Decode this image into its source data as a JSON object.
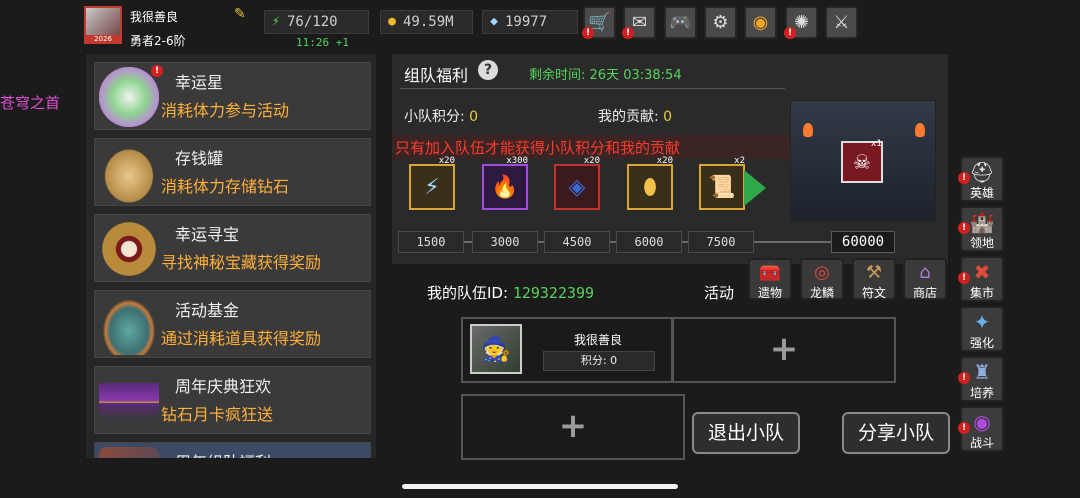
{
  "player": {
    "name": "我很善良",
    "rank": "勇者2-6阶",
    "avatar_level": "2026"
  },
  "stats": {
    "stamina": "76/120",
    "gold": "49.59M",
    "diamonds": "19977",
    "clock": "11:26 +1"
  },
  "topbar_icons": [
    "shop-cart-icon",
    "mail-icon",
    "gamepad-icon",
    "settings-gear-icon",
    "color-wheel-icon",
    "firework-icon",
    "battle-icon"
  ],
  "side_cut_text": "苍穹之首",
  "activities": [
    {
      "title": "幸运星",
      "desc": "消耗体力参与活动",
      "icon": "lucky-star-icon",
      "alert": true
    },
    {
      "title": "存钱罐",
      "desc": "消耗体力存储钻石",
      "icon": "piggy-bank-icon",
      "alert": false
    },
    {
      "title": "幸运寻宝",
      "desc": "寻找神秘宝藏获得奖励",
      "icon": "treasure-icon",
      "alert": false
    },
    {
      "title": "活动基金",
      "desc": "通过消耗道具获得奖励",
      "icon": "fund-bag-icon",
      "alert": false
    },
    {
      "title": "周年庆典狂欢",
      "desc": "钻石月卡疯狂送",
      "icon": "anniversary-icon",
      "alert": false
    },
    {
      "title": "周年组队福利",
      "desc": "",
      "icon": "team-icon",
      "alert": false
    }
  ],
  "panel": {
    "title": "组队福利",
    "help": "?",
    "remaining_label": "剩余时间:",
    "remaining_value": "26天 03:38:54",
    "team_score_label": "小队积分:",
    "team_score": "0",
    "my_contrib_label": "我的贡献:",
    "my_contrib": "0",
    "warning": "只有加入队伍才能获得小队积分和我的贡献",
    "rewards": [
      {
        "icon": "lightning-icon",
        "qty": "x20",
        "border": "#d8a733"
      },
      {
        "icon": "fire-staff-icon",
        "qty": "x300",
        "border": "#a24be0"
      },
      {
        "icon": "blue-gem-icon",
        "qty": "x20",
        "border": "#c83030"
      },
      {
        "icon": "golden-egg-icon",
        "qty": "x20",
        "border": "#d8a733"
      },
      {
        "icon": "scroll-icon",
        "qty": "x2",
        "border": "#d8a733"
      }
    ],
    "milestones": [
      "1500",
      "3000",
      "4500",
      "6000",
      "7500"
    ],
    "final_milestone": "60000",
    "boss_qty": "x1"
  },
  "quick_chips": [
    {
      "label": "遗物",
      "icon": "relic-chest-icon"
    },
    {
      "label": "龙鳞",
      "icon": "dragon-scale-icon"
    },
    {
      "label": "符文",
      "icon": "rune-icon"
    },
    {
      "label": "商店",
      "icon": "shop-icon"
    }
  ],
  "right_menu": [
    {
      "label": "英雄",
      "icon": "hero-helmet-icon",
      "alert": true
    },
    {
      "label": "领地",
      "icon": "castle-icon",
      "alert": true
    },
    {
      "label": "集市",
      "icon": "market-icon",
      "alert": true
    },
    {
      "label": "强化",
      "icon": "enhance-icon",
      "alert": false
    },
    {
      "label": "培养",
      "icon": "train-icon",
      "alert": true
    },
    {
      "label": "战斗",
      "icon": "battle-portal-icon",
      "alert": true
    }
  ],
  "team": {
    "id_label": "我的队伍ID:",
    "id": "129322399",
    "activity_label": "活动",
    "member_name": "我很善良",
    "member_score": "积分: 0",
    "plus": "+"
  },
  "buttons": {
    "leave": "退出小队",
    "share": "分享小队"
  }
}
